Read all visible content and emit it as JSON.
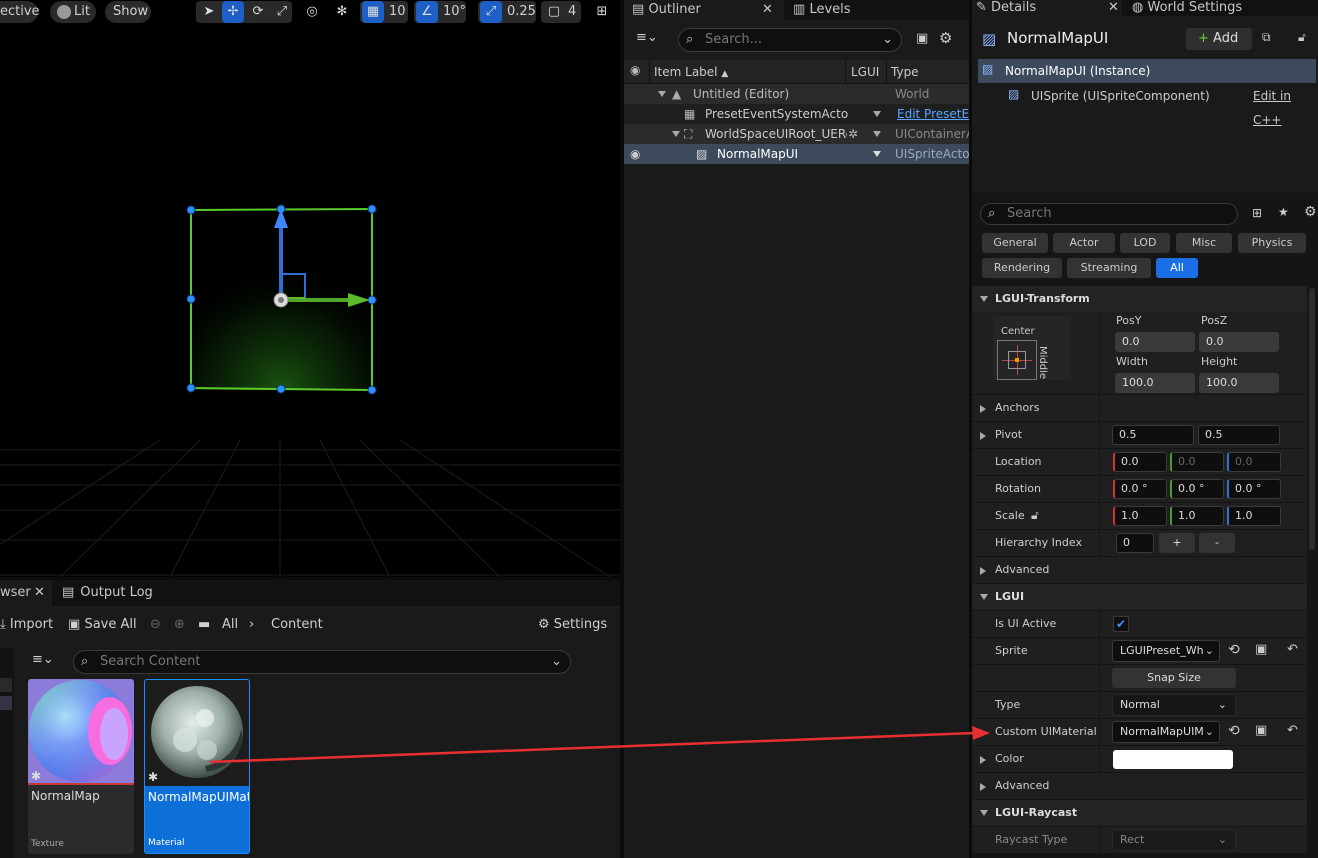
{
  "viewport": {
    "perspective_label": "ective",
    "lit_label": "Lit",
    "show_label": "Show",
    "grid_snap": "10",
    "rotation_snap": "10°",
    "scale_snap": "0.25",
    "camera_speed": "4"
  },
  "content_browser": {
    "tab_label": "wser",
    "output_log_tab": "Output Log",
    "import_label": "Import",
    "save_all_label": "Save All",
    "path": [
      "All",
      "Content"
    ],
    "settings_label": "Settings",
    "search_placeholder": "Search Content",
    "assets": [
      {
        "name": "NormalMap",
        "type": "Texture"
      },
      {
        "name": "NormalMapUIMat",
        "type": "Material"
      }
    ]
  },
  "outliner": {
    "tab_label": "Outliner",
    "levels_tab": "Levels",
    "search_placeholder": "Search...",
    "columns": {
      "label": "Item Label",
      "lgui": "LGUI",
      "type": "Type"
    },
    "rows": [
      {
        "label": "Untitled (Editor)",
        "type": "World"
      },
      {
        "label": "PresetEventSystemActor",
        "type": "Edit PresetE"
      },
      {
        "label": "WorldSpaceUIRoot_UERe",
        "type": "UIContainerA"
      },
      {
        "label": "NormalMapUI",
        "type": "UISpriteActo"
      }
    ]
  },
  "details": {
    "tab_label": "Details",
    "world_settings_tab": "World Settings",
    "actor_name": "NormalMapUI",
    "add_label": "Add",
    "components": [
      {
        "label": "NormalMapUI (Instance)"
      },
      {
        "label": "UISprite (UISpriteComponent)",
        "action": "Edit in C++"
      }
    ],
    "search_placeholder": "Search",
    "filters": [
      "General",
      "Actor",
      "LOD",
      "Misc",
      "Physics",
      "Rendering",
      "Streaming",
      "All"
    ],
    "transform": {
      "section": "LGUI-Transform",
      "anchor_h": "Center",
      "anchor_v": "Middle",
      "posy_label": "PosY",
      "posy": "0.0",
      "posz_label": "PosZ",
      "posz": "0.0",
      "width_label": "Width",
      "width": "100.0",
      "height_label": "Height",
      "height": "100.0",
      "anchors_label": "Anchors",
      "pivot_label": "Pivot",
      "pivot": [
        "0.5",
        "0.5"
      ],
      "location_label": "Location",
      "location": [
        "0.0",
        "0.0",
        "0.0"
      ],
      "rotation_label": "Rotation",
      "rotation": [
        "0.0 °",
        "0.0 °",
        "0.0 °"
      ],
      "scale_label": "Scale",
      "scale": [
        "1.0",
        "1.0",
        "1.0"
      ],
      "hierarchy_label": "Hierarchy Index",
      "hierarchy": "0",
      "plus": "+",
      "minus": "-",
      "advanced_label": "Advanced"
    },
    "lgui": {
      "section": "LGUI",
      "active_label": "Is UI Active",
      "sprite_label": "Sprite",
      "sprite": "LGUIPreset_Wh",
      "snap_label": "Snap Size",
      "type_label": "Type",
      "type": "Normal",
      "material_label": "Custom UIMaterial",
      "material": "NormalMapUIM",
      "color_label": "Color",
      "advanced_label": "Advanced"
    },
    "raycast": {
      "section": "LGUI-Raycast",
      "type_label": "Raycast Type",
      "type": "Rect"
    }
  }
}
